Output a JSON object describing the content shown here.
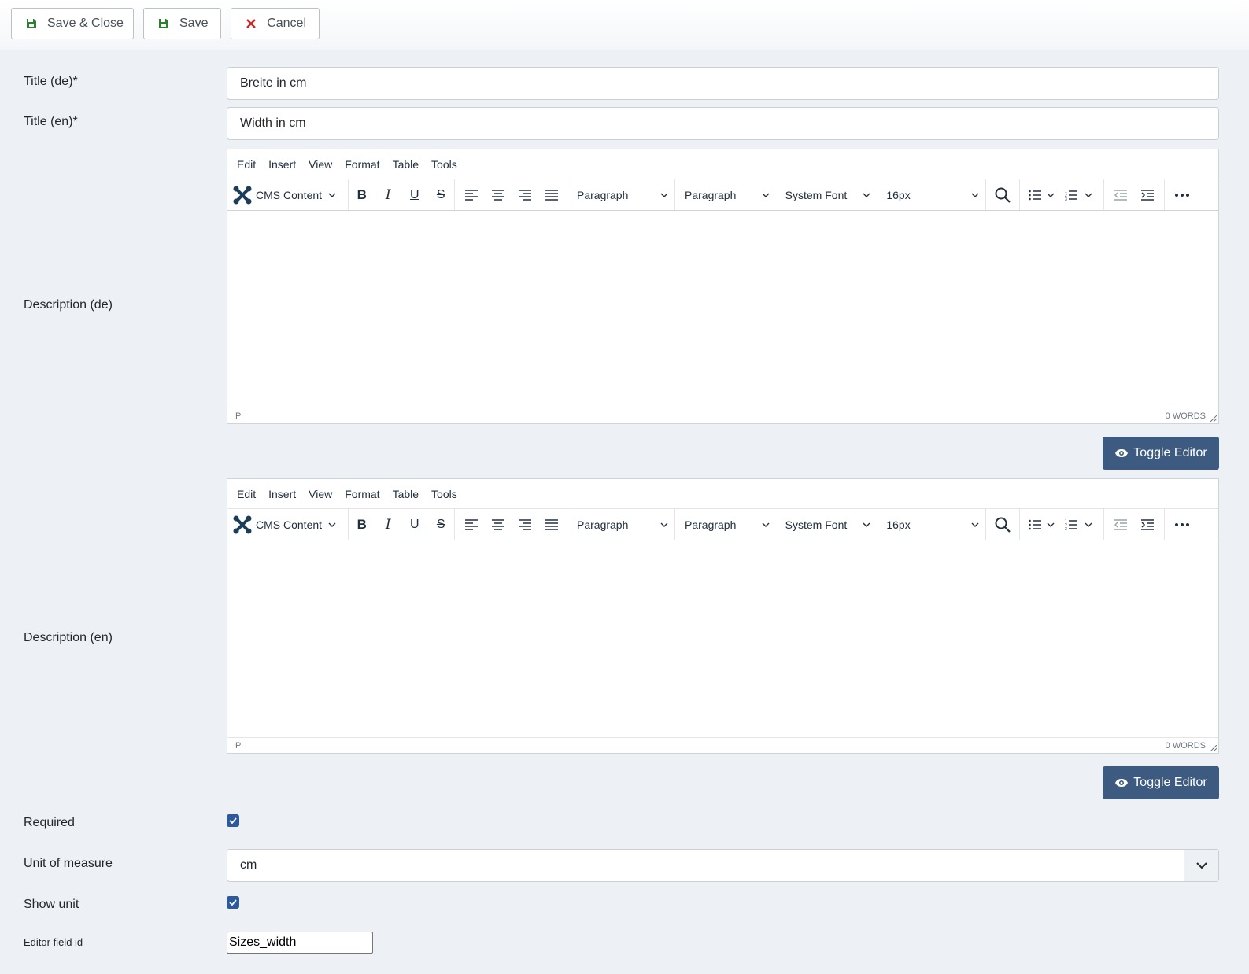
{
  "toolbar": {
    "save_close": "Save & Close",
    "save": "Save",
    "cancel": "Cancel"
  },
  "fields": {
    "title_de": {
      "label": "Title (de)*",
      "value": "Breite in cm"
    },
    "title_en": {
      "label": "Title (en)*",
      "value": "Width in cm"
    },
    "description_de": {
      "label": "Description (de)"
    },
    "description_en": {
      "label": "Description (en)"
    },
    "required": {
      "label": "Required",
      "checked": true
    },
    "unit": {
      "label": "Unit of measure",
      "value": "cm"
    },
    "show_unit": {
      "label": "Show unit",
      "checked": true
    },
    "editor_field_id": {
      "label": "Editor field id",
      "value": "Sizes_width"
    }
  },
  "editor": {
    "menu": [
      "Edit",
      "Insert",
      "View",
      "Format",
      "Table",
      "Tools"
    ],
    "cms_content": "CMS Content",
    "block_format": "Paragraph",
    "block_format2": "Paragraph",
    "font_family": "System Font",
    "font_size": "16px",
    "status_path": "P",
    "word_count": "0 WORDS"
  },
  "toggle_editor": "Toggle Editor",
  "colors": {
    "accent": "#3d5a80",
    "checkbox": "#2d5a9a",
    "save_icon": "#2f7d32",
    "cancel_icon": "#c52827"
  }
}
